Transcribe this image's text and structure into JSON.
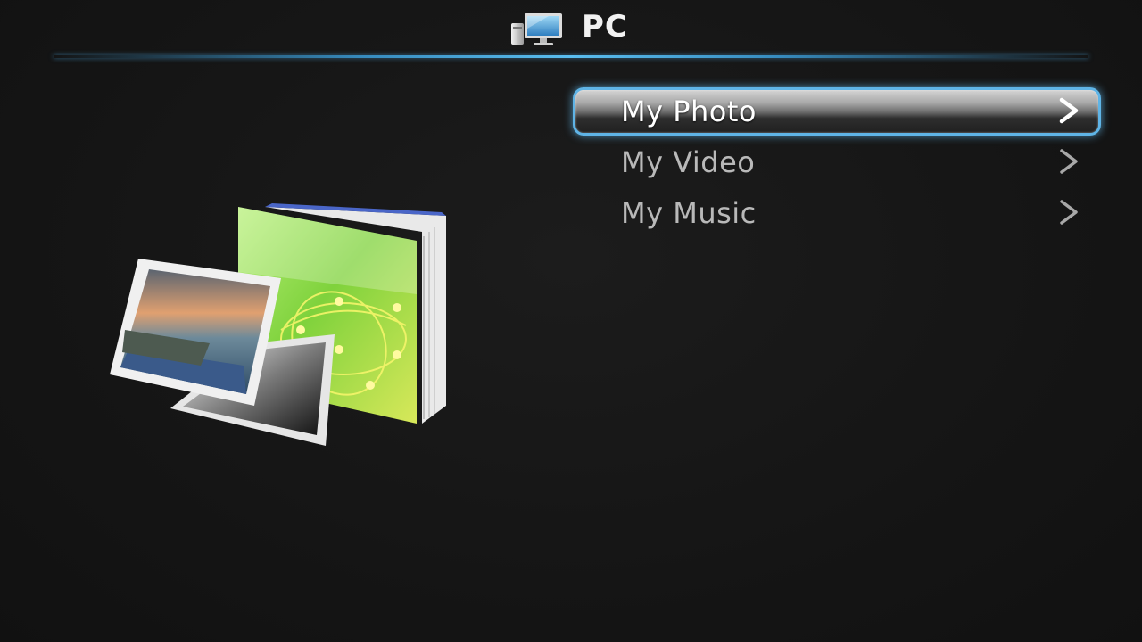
{
  "header": {
    "title": "PC",
    "icon": "pc-monitor-icon"
  },
  "menu": {
    "items": [
      {
        "label": "My Photo",
        "selected": true,
        "icon": "chevron-right-icon"
      },
      {
        "label": "My Video",
        "selected": false,
        "icon": "chevron-right-icon"
      },
      {
        "label": "My Music",
        "selected": false,
        "icon": "chevron-right-icon"
      }
    ]
  },
  "preview": {
    "icon": "photo-album-icon"
  },
  "colors": {
    "background": "#141414",
    "accent": "#5fb4e6",
    "text_selected": "#ffffff",
    "text_normal": "#b9b9b9"
  }
}
